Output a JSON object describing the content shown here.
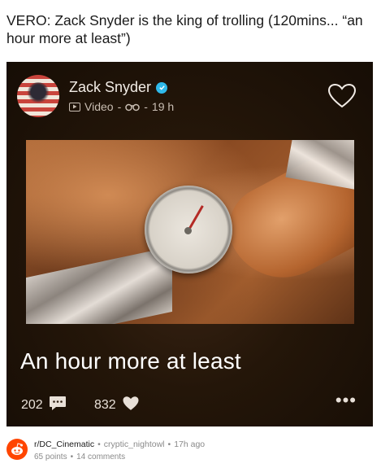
{
  "post": {
    "title": "VERO: Zack Snyder is the king of trolling (120mins... “an hour more at least”)"
  },
  "card": {
    "author": "Zack Snyder",
    "meta_type": "Video",
    "meta_sep": "-",
    "meta_time": "19 h",
    "caption": "An hour more at least",
    "comments_count": "202",
    "likes_count": "832",
    "more": "•••",
    "icons": {
      "verified": "verified-badge-icon",
      "video": "video-icon",
      "views": "binoculars-icon",
      "like_top": "heart-outline-icon",
      "comment": "comment-icon",
      "like": "heart-icon"
    }
  },
  "footer": {
    "subreddit": "r/DC_Cinematic",
    "author": "cryptic_nightowl",
    "time": "17h ago",
    "points": "65 points",
    "comments": "14 comments"
  },
  "colors": {
    "reddit": "#ff4500",
    "verified": "#2fb9ea",
    "card_bg": "#1e1209"
  }
}
